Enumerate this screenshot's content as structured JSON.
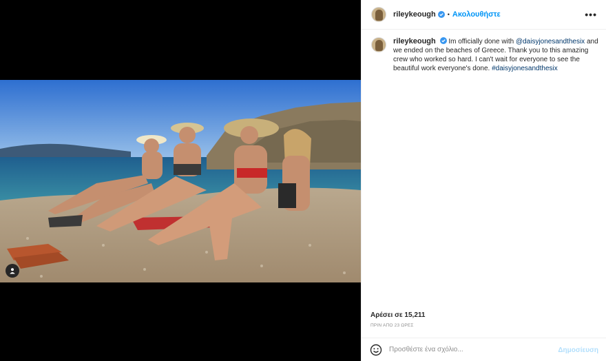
{
  "post": {
    "username": "rileykeough",
    "follow_label": "Ακολουθήστε",
    "separator": "•",
    "more_label": "•••",
    "caption_prefix": "Im officially done with ",
    "caption_mention": "@daisyjonesandthesix",
    "caption_middle": " and we ended on the beaches of Greece. Thank you to this amazing crew who worked so hard. I can't wait for everyone to see the beautiful work everyone's done. ",
    "caption_hashtag": "#daisyjonesandthesix",
    "likes": "Αρέσει σε 15,211",
    "timestamp": "ΠΡΙΝ ΑΠΟ 23 ΩΡΕΣ"
  },
  "comment": {
    "placeholder": "Προσθέστε ένα σχόλιο...",
    "post_label": "Δημοσίευση"
  },
  "colors": {
    "accent": "#0095f6",
    "link": "#00376b",
    "verified": "#3897f0"
  },
  "icons": [
    "verified-badge-icon",
    "more-options-icon",
    "emoji-icon",
    "user-tag-icon"
  ]
}
